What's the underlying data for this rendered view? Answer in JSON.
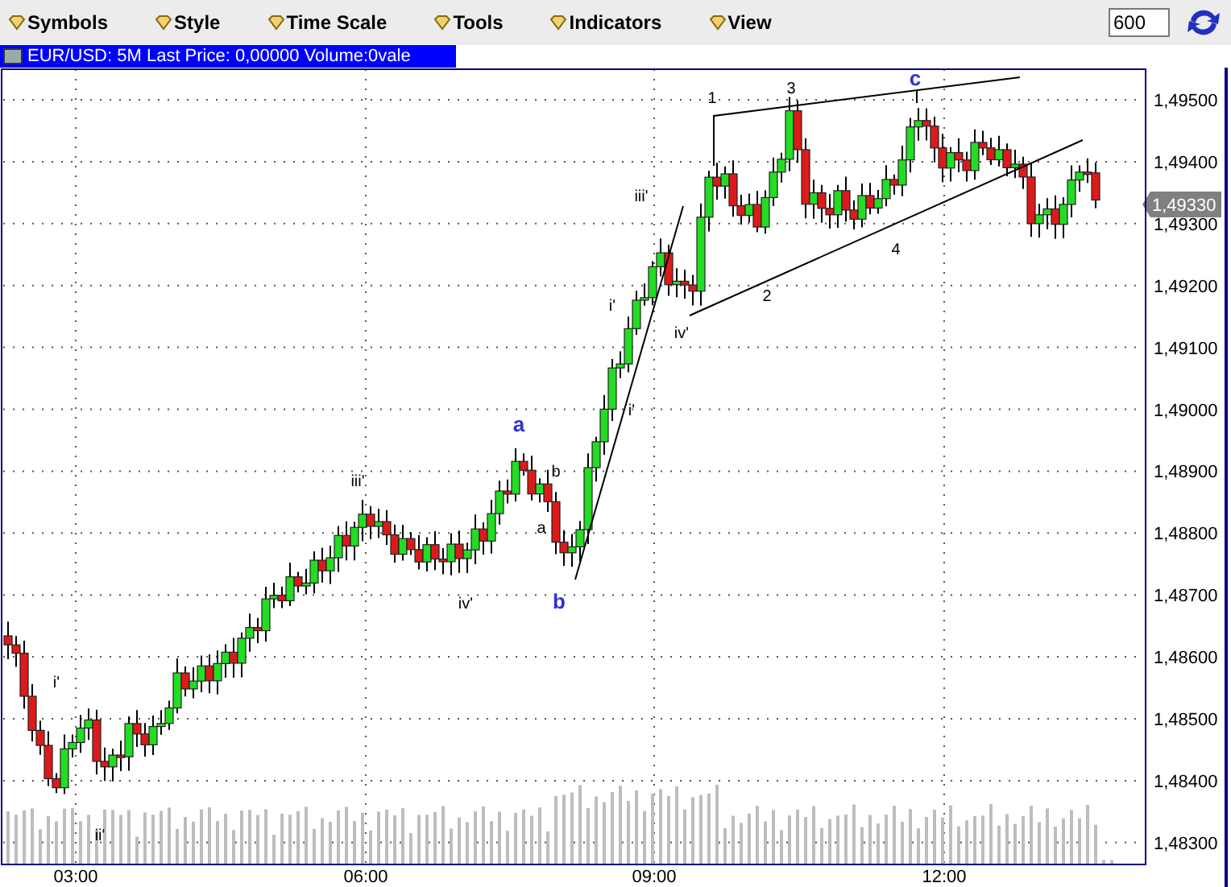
{
  "toolbar": {
    "menus": [
      "Symbols",
      "Style",
      "Time Scale",
      "Tools",
      "Indicators",
      "View"
    ],
    "period_field": {
      "value": "600"
    }
  },
  "chart": {
    "title": "EUR/USD: 5M Last Price: 0,00000 Volume:0vale",
    "y_axis_labels": [
      "1,49500",
      "1,49400",
      "1,49300",
      "1,49200",
      "1,49100",
      "1,49000",
      "1,48900",
      "1,48800",
      "1,48700",
      "1,48600",
      "1,48500",
      "1,48400",
      "1,48300"
    ],
    "x_axis_labels": [
      "03:00",
      "06:00",
      "09:00",
      "12:00"
    ],
    "price_tag": "1,49330",
    "wave_labels": [
      {
        "text": "i'",
        "kind": "minor"
      },
      {
        "text": "ii'",
        "kind": "minor"
      },
      {
        "text": "iii'",
        "kind": "minor"
      },
      {
        "text": "iv'",
        "kind": "minor"
      },
      {
        "text": "a",
        "kind": "major"
      },
      {
        "text": "b",
        "kind": "minor"
      },
      {
        "text": "a",
        "kind": "minor"
      },
      {
        "text": "b",
        "kind": "major"
      },
      {
        "text": "i'",
        "kind": "minor"
      },
      {
        "text": "i'",
        "kind": "minor"
      },
      {
        "text": "iii'",
        "kind": "minor"
      },
      {
        "text": "iv'",
        "kind": "minor"
      },
      {
        "text": "1",
        "kind": "minor"
      },
      {
        "text": "3",
        "kind": "minor"
      },
      {
        "text": "c",
        "kind": "major"
      },
      {
        "text": "2",
        "kind": "minor"
      },
      {
        "text": "4",
        "kind": "minor"
      }
    ]
  }
}
